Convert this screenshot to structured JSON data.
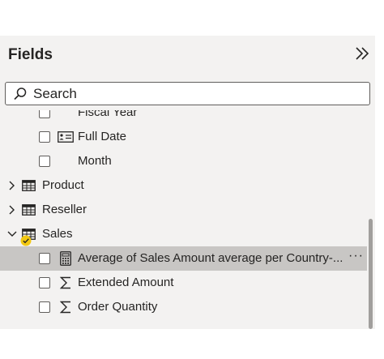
{
  "pane": {
    "title": "Fields",
    "collapse_icon": "double-chevron-right-icon"
  },
  "search": {
    "placeholder": "Search",
    "icon": "search-icon"
  },
  "items": {
    "fiscal_year": {
      "label": "Fiscal Year"
    },
    "full_date": {
      "label": "Full Date",
      "icon": "date-hierarchy-icon"
    },
    "month": {
      "label": "Month"
    },
    "product": {
      "label": "Product",
      "icon": "table-icon",
      "expanded": false
    },
    "reseller": {
      "label": "Reseller",
      "icon": "table-icon",
      "expanded": false
    },
    "sales": {
      "label": "Sales",
      "icon": "table-icon",
      "expanded": true,
      "badge": "checkmark-badge-icon"
    },
    "avg_measure": {
      "label": "Average of Sales Amount average per Country-...",
      "icon": "calculator-icon",
      "more": "···"
    },
    "extended": {
      "label": "Extended Amount",
      "icon": "sigma-icon"
    },
    "order_qty": {
      "label": "Order Quantity",
      "icon": "sigma-icon"
    }
  },
  "colors": {
    "pane_bg": "#f3f2f1",
    "selected_row": "#c8c6c4",
    "text": "#252423",
    "badge": "#f2c811"
  }
}
